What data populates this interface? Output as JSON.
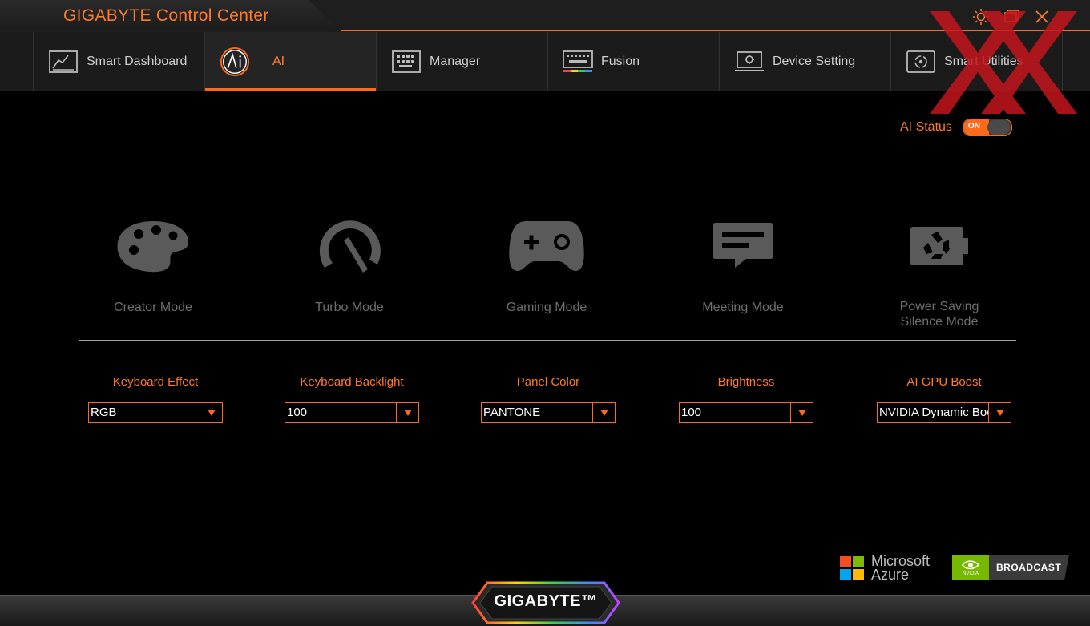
{
  "app": {
    "title": "GIGABYTE Control Center"
  },
  "tabs": [
    {
      "label": "Smart Dashboard",
      "icon": "dashboard-icon",
      "active": false
    },
    {
      "label": "AI",
      "icon": "ai-icon",
      "active": true
    },
    {
      "label": "Manager",
      "icon": "keyboard-grid-icon",
      "active": false
    },
    {
      "label": "Fusion",
      "icon": "rgb-keyboard-icon",
      "active": false
    },
    {
      "label": "Device Setting",
      "icon": "laptop-gear-icon",
      "active": false
    },
    {
      "label": "Smart Utilities",
      "icon": "utilities-icon",
      "active": false
    }
  ],
  "ai_status": {
    "label": "AI Status",
    "toggle_text": "ON",
    "enabled": true
  },
  "modes": [
    {
      "label": "Creator Mode",
      "icon": "palette-icon"
    },
    {
      "label": "Turbo Mode",
      "icon": "speedometer-icon"
    },
    {
      "label": "Gaming Mode",
      "icon": "gamepad-icon"
    },
    {
      "label": "Meeting Mode",
      "icon": "chat-bubble-icon"
    },
    {
      "label": "Power Saving\nSilence Mode",
      "icon": "recycle-battery-icon"
    }
  ],
  "settings": [
    {
      "label": "Keyboard Effect",
      "value": "RGB"
    },
    {
      "label": "Keyboard Backlight",
      "value": "100"
    },
    {
      "label": "Panel Color",
      "value": "PANTONE"
    },
    {
      "label": "Brightness",
      "value": "100"
    },
    {
      "label": "AI GPU Boost",
      "value": "NVIDIA Dynamic Boost"
    }
  ],
  "logos": {
    "microsoft_line1": "Microsoft",
    "microsoft_line2": "Azure",
    "nvidia_small": "NVIDIA",
    "nvidia_text": "BROADCAST",
    "brand": "GIGABYTE™"
  },
  "colors": {
    "accent": "#ff6a1a",
    "mode_icon": "#5a5a5a",
    "mode_text": "#6e6e6e"
  }
}
